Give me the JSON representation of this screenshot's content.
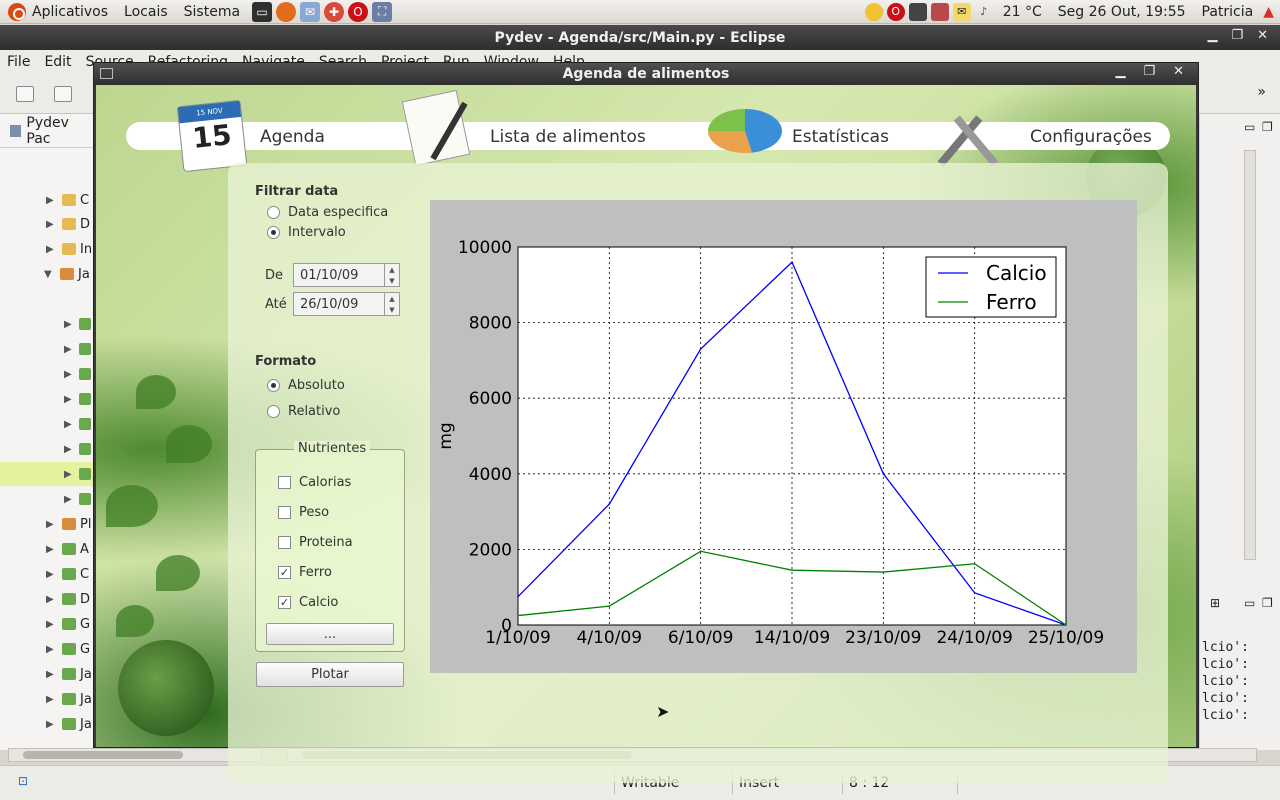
{
  "top_panel": {
    "menus": [
      "Aplicativos",
      "Locais",
      "Sistema"
    ],
    "weather": "21 °C",
    "clock": "Seg 26 Out, 19:55",
    "user": "Patricia"
  },
  "eclipse": {
    "title": "Pydev - Agenda/src/Main.py - Eclipse",
    "menu": [
      "File",
      "Edit",
      "Source",
      "Refactoring",
      "Navigate",
      "Search",
      "Project",
      "Run",
      "Window",
      "Help"
    ],
    "package_explorer_label": "Pydev Pac",
    "tree_items": [
      "C",
      "D",
      "In",
      "Ja",
      "",
      "",
      "",
      "",
      "",
      "",
      "",
      "",
      "",
      "Pl",
      "A",
      "C",
      "D",
      "G",
      "G",
      "Ja",
      "Ja",
      "Ja"
    ],
    "console_lines": [
      "lcio':",
      "lcio':",
      "lcio':",
      "lcio':",
      "lcio':"
    ],
    "status": {
      "writable": "Writable",
      "insert": "Insert",
      "position": "8 : 12"
    }
  },
  "app": {
    "title": "Agenda de alimentos",
    "nav": [
      {
        "label": "Agenda",
        "icon": "calendar-icon",
        "calendar_day": "15",
        "calendar_month": "15 NOV"
      },
      {
        "label": "Lista de alimentos",
        "icon": "document-icon"
      },
      {
        "label": "Estatísticas",
        "icon": "pie-chart-icon"
      },
      {
        "label": "Configurações",
        "icon": "tools-icon"
      }
    ],
    "filter": {
      "title": "Filtrar data",
      "options": [
        {
          "label": "Data especifica",
          "selected": false
        },
        {
          "label": "Intervalo",
          "selected": true
        }
      ],
      "from_label": "De",
      "from_value": "01/10/09",
      "to_label": "Até",
      "to_value": "26/10/09"
    },
    "format": {
      "title": "Formato",
      "options": [
        {
          "label": "Absoluto",
          "selected": true
        },
        {
          "label": "Relativo",
          "selected": false
        }
      ]
    },
    "nutrients": {
      "title": "Nutrientes",
      "items": [
        {
          "label": "Calorias",
          "checked": false
        },
        {
          "label": "Peso",
          "checked": false
        },
        {
          "label": "Proteina",
          "checked": false
        },
        {
          "label": "Ferro",
          "checked": true
        },
        {
          "label": "Calcio",
          "checked": true
        }
      ],
      "more_button": "...",
      "plot_button": "Plotar"
    }
  },
  "chart_data": {
    "type": "line",
    "title": "",
    "xlabel": "",
    "ylabel": "mg",
    "categories": [
      "1/10/09",
      "4/10/09",
      "6/10/09",
      "14/10/09",
      "23/10/09",
      "24/10/09",
      "25/10/09"
    ],
    "ylim": [
      0,
      10000
    ],
    "yticks": [
      0,
      2000,
      4000,
      6000,
      8000,
      10000
    ],
    "grid": true,
    "legend_position": "top-right",
    "series": [
      {
        "name": "Calcio",
        "color": "#0000ff",
        "values": [
          750,
          3200,
          7300,
          9600,
          4000,
          850,
          0
        ]
      },
      {
        "name": "Ferro",
        "color": "#008000",
        "values": [
          250,
          500,
          1950,
          1450,
          1400,
          1620,
          0
        ]
      }
    ]
  }
}
